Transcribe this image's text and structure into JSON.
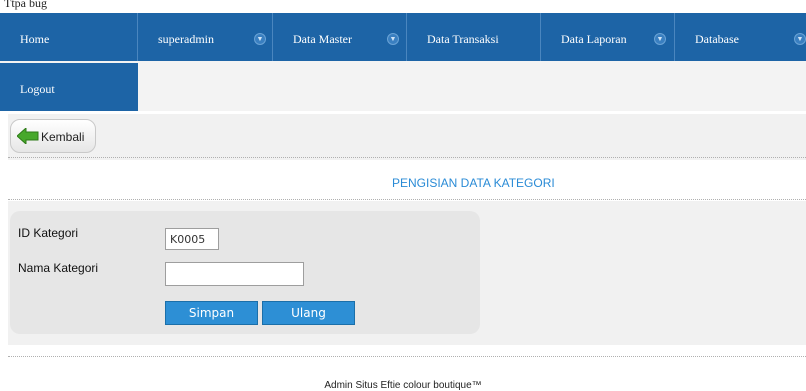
{
  "topbar": {
    "text": "Ttpa bug"
  },
  "nav": {
    "items": [
      {
        "label": "Home"
      },
      {
        "label": "superadmin"
      },
      {
        "label": "Data Master"
      },
      {
        "label": "Data Transaksi"
      },
      {
        "label": "Data Laporan"
      },
      {
        "label": "Database"
      }
    ],
    "logout": "Logout",
    "accent": "#1d64a6"
  },
  "back_button": {
    "label": "Kembali",
    "icon": "arrow-left-icon"
  },
  "page": {
    "title": "PENGISIAN DATA KATEGORI"
  },
  "form": {
    "id_label": "ID Kategori",
    "id_value": "K0005",
    "name_label": "Nama Kategori",
    "name_value": "",
    "save_label": "Simpan",
    "reset_label": "Ulang"
  },
  "footer": {
    "text": "Admin Situs Eftie colour boutique™"
  }
}
